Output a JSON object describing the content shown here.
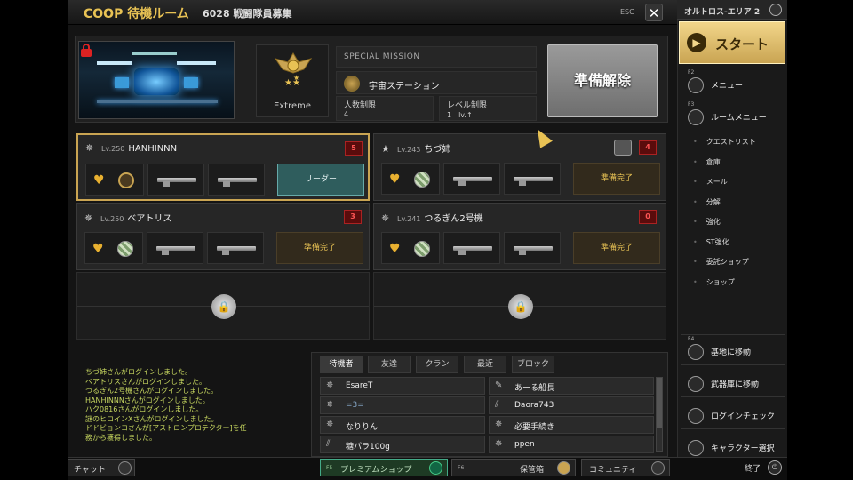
{
  "room": {
    "title": "COOP 待機ルーム",
    "number_title": "6028 戦闘隊員募集",
    "esc_label": "ESC",
    "close_glyph": "✕"
  },
  "mission": {
    "type_label": "SPECIAL MISSION",
    "map_name": "宇宙ステーション",
    "difficulty": "Extreme",
    "player_limit_label": "人数制限",
    "player_limit_value": "4",
    "level_limit_label": "レベル制限",
    "level_limit_value": "1　lv.↑",
    "ready_cancel_label": "準備解除",
    "lock_icon": "lock-icon",
    "rank_icon": "eagle-emblem-icon"
  },
  "slots": [
    {
      "rank_glyph": "✵",
      "level": "Lv.250",
      "name": "HANHINNN",
      "badge": "5",
      "status": "リーダー"
    },
    {
      "rank_glyph": "★",
      "level": "Lv.243",
      "name": "ちづ姉",
      "badge": "4",
      "status": "準備完了"
    },
    {
      "rank_glyph": "✵",
      "level": "Lv.250",
      "name": "ベアトリス",
      "badge": "3",
      "status": "準備完了"
    },
    {
      "rank_glyph": "✵",
      "level": "Lv.241",
      "name": "つるぎん2号機",
      "badge": "0",
      "status": "準備完了"
    }
  ],
  "chat_log": [
    "ちづ姉さんがログインしました。",
    "ベアトリスさんがログインしました。",
    "つるぎん2号機さんがログインしました。",
    "HANHINNNさんがログインしました。",
    "ハク0816さんがログインしました。",
    "謎のヒロインXさんがログインしました。",
    "ドドビョンコさんが[アストロンプロテクター]を任",
    "務から獲得しました。"
  ],
  "friends": {
    "tabs": [
      "待機者",
      "友達",
      "クラン",
      "最近",
      "ブロック"
    ],
    "entries": [
      "EsareT",
      "あーる船長",
      "=3=",
      "Daora743",
      "なりりん",
      "必要手続き",
      "糖パラ100g",
      "ppen"
    ]
  },
  "bottom": {
    "chat": "チャット",
    "premium_key": "F5",
    "premium": "プレミアムショップ",
    "storage_key": "F6",
    "storage": "保管箱",
    "community": "コミュニティ",
    "end": "終了"
  },
  "sidebar": {
    "area": "オルトロス-エリア 2",
    "start": "スタート",
    "menu_key": "F2",
    "menu": "メニュー",
    "room_menu_key": "F3",
    "room_menu": "ルームメニュー",
    "sub_items": [
      "クエストリスト",
      "倉庫",
      "メール",
      "分解",
      "強化",
      "ST強化",
      "委託ショップ",
      "ショップ"
    ],
    "base_key": "F4",
    "base": "基地に移動",
    "armory": "武器庫に移動",
    "login_check": "ログインチェック",
    "char_select": "キャラクター選択"
  },
  "colors": {
    "accent": "#c9a452",
    "ready": "#e8c254",
    "badge": "#a22222",
    "chat": "#c8d860"
  }
}
